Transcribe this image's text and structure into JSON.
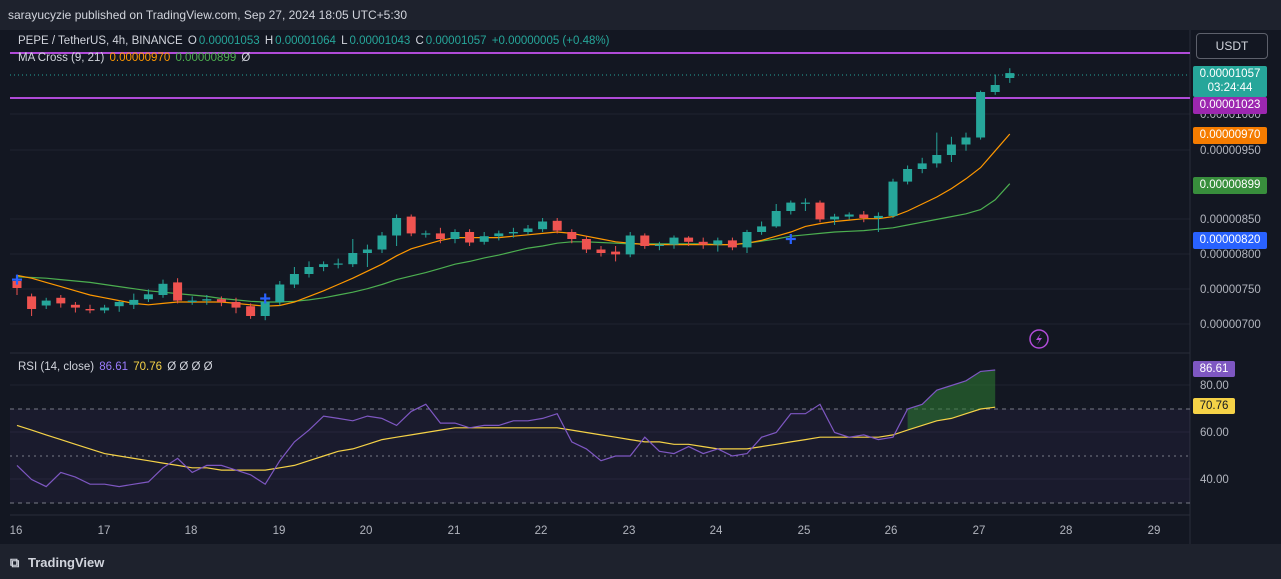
{
  "header": {
    "published": "sarayucyzie published on TradingView.com, Sep 27, 2024 18:05 UTC+5:30"
  },
  "legend": {
    "symbol": "PEPE / TetherUS, 4h, BINANCE",
    "o_label": "O",
    "o_value": "0.00001053",
    "h_label": "H",
    "h_value": "0.00001064",
    "l_label": "L",
    "l_value": "0.00001043",
    "c_label": "C",
    "c_value": "0.00001057",
    "change": "+0.00000005 (+0.48%)",
    "ma_label": "MA Cross (9, 21)",
    "ma_fast": "0.00000970",
    "ma_slow": "0.00000899",
    "ma_extra": "Ø"
  },
  "rsi_legend": {
    "label": "RSI (14, close)",
    "rsi": "86.61",
    "ma": "70.76",
    "extras": "Ø Ø Ø Ø"
  },
  "currency_button": "USDT",
  "price_axis": {
    "labels": [
      "0.00001000",
      "0.00000950",
      "0.00000850",
      "0.00000800",
      "0.00000750",
      "0.00000700"
    ],
    "tags": {
      "last_price": "0.00001057",
      "countdown": "03:24:44",
      "resistance": "0.00001023",
      "ma_fast": "0.00000970",
      "ma_slow": "0.00000899",
      "cross": "0.00000820"
    }
  },
  "rsi_axis": {
    "labels": [
      "80.00",
      "60.00",
      "40.00"
    ],
    "rsi_tag": "86.61",
    "ma_tag": "70.76"
  },
  "time_axis": [
    "16",
    "17",
    "18",
    "19",
    "20",
    "21",
    "22",
    "23",
    "24",
    "25",
    "26",
    "27",
    "28",
    "29"
  ],
  "footer": {
    "brand": "TradingView"
  },
  "colors": {
    "up": "#26a69a",
    "down": "#ef5350",
    "ma_fast": "#ff9800",
    "ma_slow": "#4caf50",
    "level": "#b04bd8",
    "rsi": "#7e57c2",
    "rsi_ma": "#f5d247",
    "cross": "#2962ff"
  },
  "chart_data": [
    {
      "type": "candlestick",
      "title": "PEPE / TetherUS, 4h, BINANCE",
      "x_labels": [
        "16",
        "17",
        "18",
        "19",
        "20",
        "21",
        "22",
        "23",
        "24",
        "25",
        "26",
        "27",
        "28",
        "29"
      ],
      "ylim": [
        6.8e-06,
        1.08e-05
      ],
      "horizontal_levels": [
        1.04e-05,
        1.023e-05
      ],
      "candles": [
        [
          7.6,
          7.5,
          7.68,
          7.4
        ],
        [
          7.38,
          7.2,
          7.42,
          7.1
        ],
        [
          7.25,
          7.32,
          7.36,
          7.2
        ],
        [
          7.36,
          7.28,
          7.4,
          7.22
        ],
        [
          7.26,
          7.22,
          7.3,
          7.15
        ],
        [
          7.2,
          7.18,
          7.26,
          7.14
        ],
        [
          7.18,
          7.22,
          7.26,
          7.14
        ],
        [
          7.24,
          7.3,
          7.32,
          7.16
        ],
        [
          7.26,
          7.33,
          7.42,
          7.2
        ],
        [
          7.34,
          7.41,
          7.48,
          7.3
        ],
        [
          7.4,
          7.56,
          7.62,
          7.36
        ],
        [
          7.58,
          7.32,
          7.64,
          7.28
        ],
        [
          7.3,
          7.32,
          7.38,
          7.26
        ],
        [
          7.32,
          7.34,
          7.4,
          7.26
        ],
        [
          7.34,
          7.3,
          7.38,
          7.24
        ],
        [
          7.3,
          7.22,
          7.36,
          7.14
        ],
        [
          7.24,
          7.1,
          7.28,
          7.06
        ],
        [
          7.1,
          7.3,
          7.32,
          7.04
        ],
        [
          7.3,
          7.55,
          7.6,
          7.25
        ],
        [
          7.55,
          7.7,
          7.8,
          7.5
        ],
        [
          7.7,
          7.8,
          7.88,
          7.65
        ],
        [
          7.8,
          7.84,
          7.88,
          7.74
        ],
        [
          7.84,
          7.85,
          7.92,
          7.78
        ],
        [
          7.84,
          8.0,
          8.2,
          7.8
        ],
        [
          8.0,
          8.05,
          8.12,
          7.8
        ],
        [
          8.05,
          8.25,
          8.3,
          8.0
        ],
        [
          8.25,
          8.5,
          8.55,
          8.1
        ],
        [
          8.52,
          8.28,
          8.55,
          8.24
        ],
        [
          8.28,
          8.28,
          8.32,
          8.22
        ],
        [
          8.28,
          8.2,
          8.36,
          8.14
        ],
        [
          8.2,
          8.3,
          8.34,
          8.14
        ],
        [
          8.3,
          8.15,
          8.34,
          8.1
        ],
        [
          8.16,
          8.24,
          8.3,
          8.12
        ],
        [
          8.24,
          8.28,
          8.32,
          8.18
        ],
        [
          8.28,
          8.3,
          8.36,
          8.22
        ],
        [
          8.3,
          8.35,
          8.4,
          8.26
        ],
        [
          8.34,
          8.45,
          8.5,
          8.3
        ],
        [
          8.46,
          8.32,
          8.5,
          8.28
        ],
        [
          8.3,
          8.2,
          8.34,
          8.14
        ],
        [
          8.2,
          8.05,
          8.24,
          8.0
        ],
        [
          8.05,
          8.0,
          8.1,
          7.95
        ],
        [
          8.02,
          7.98,
          8.1,
          7.88
        ],
        [
          7.98,
          8.25,
          8.3,
          7.94
        ],
        [
          8.25,
          8.1,
          8.28,
          8.06
        ],
        [
          8.1,
          8.12,
          8.16,
          8.04
        ],
        [
          8.12,
          8.22,
          8.25,
          8.06
        ],
        [
          8.22,
          8.16,
          8.24,
          8.1
        ],
        [
          8.16,
          8.12,
          8.22,
          8.06
        ],
        [
          8.12,
          8.18,
          8.22,
          8.02
        ],
        [
          8.18,
          8.08,
          8.22,
          8.04
        ],
        [
          8.08,
          8.3,
          8.33,
          8.0
        ],
        [
          8.3,
          8.38,
          8.45,
          8.26
        ],
        [
          8.38,
          8.6,
          8.7,
          8.36
        ],
        [
          8.6,
          8.72,
          8.75,
          8.55
        ],
        [
          8.72,
          8.72,
          8.78,
          8.6
        ],
        [
          8.72,
          8.48,
          8.75,
          8.44
        ],
        [
          8.48,
          8.52,
          8.56,
          8.4
        ],
        [
          8.52,
          8.55,
          8.58,
          8.48
        ],
        [
          8.55,
          8.5,
          8.6,
          8.44
        ],
        [
          8.5,
          8.53,
          8.58,
          8.3
        ],
        [
          8.53,
          9.02,
          9.06,
          8.5
        ],
        [
          9.02,
          9.2,
          9.25,
          8.98
        ],
        [
          9.2,
          9.28,
          9.36,
          9.14
        ],
        [
          9.28,
          9.4,
          9.72,
          9.22
        ],
        [
          9.4,
          9.55,
          9.66,
          9.3
        ],
        [
          9.55,
          9.65,
          9.72,
          9.46
        ],
        [
          9.65,
          10.3,
          10.32,
          9.62
        ],
        [
          10.3,
          10.4,
          10.55,
          10.26
        ],
        [
          10.5,
          10.57,
          10.64,
          10.43
        ]
      ],
      "ma_fast_9": [
        7.68,
        7.64,
        7.58,
        7.52,
        7.46,
        7.4,
        7.36,
        7.32,
        7.28,
        7.26,
        7.28,
        7.3,
        7.3,
        7.3,
        7.3,
        7.28,
        7.26,
        7.24,
        7.25,
        7.3,
        7.38,
        7.46,
        7.55,
        7.64,
        7.74,
        7.84,
        7.96,
        8.06,
        8.12,
        8.18,
        8.22,
        8.22,
        8.22,
        8.22,
        8.24,
        8.26,
        8.28,
        8.3,
        8.28,
        8.24,
        8.2,
        8.16,
        8.14,
        8.12,
        8.12,
        8.12,
        8.12,
        8.12,
        8.12,
        8.12,
        8.14,
        8.18,
        8.24,
        8.3,
        8.38,
        8.42,
        8.45,
        8.47,
        8.49,
        8.49,
        8.52,
        8.6,
        8.7,
        8.8,
        8.92,
        9.06,
        9.22,
        9.46,
        9.7
      ],
      "ma_slow_21": [
        7.66,
        7.65,
        7.64,
        7.62,
        7.6,
        7.58,
        7.55,
        7.52,
        7.49,
        7.46,
        7.44,
        7.42,
        7.4,
        7.38,
        7.35,
        7.33,
        7.31,
        7.3,
        7.3,
        7.31,
        7.33,
        7.36,
        7.4,
        7.44,
        7.49,
        7.55,
        7.62,
        7.67,
        7.72,
        7.78,
        7.84,
        7.88,
        7.93,
        7.97,
        8.02,
        8.07,
        8.1,
        8.14,
        8.16,
        8.16,
        8.15,
        8.14,
        8.13,
        8.13,
        8.13,
        8.13,
        8.13,
        8.13,
        8.12,
        8.12,
        8.14,
        8.17,
        8.2,
        8.24,
        8.26,
        8.28,
        8.3,
        8.31,
        8.32,
        8.34,
        8.36,
        8.4,
        8.44,
        8.48,
        8.52,
        8.56,
        8.62,
        8.76,
        8.99
      ]
    },
    {
      "type": "line",
      "title": "RSI (14, close)",
      "ylim": [
        20,
        90
      ],
      "levels": [
        70,
        50,
        30
      ],
      "series": [
        {
          "name": "RSI",
          "values": [
            46,
            40,
            37,
            43,
            41,
            38,
            38,
            37,
            38,
            39,
            45,
            49,
            43,
            46,
            46,
            44,
            42,
            38,
            48,
            56,
            61,
            67,
            66,
            65,
            67,
            66,
            63,
            69,
            72,
            64,
            64,
            62,
            63,
            63,
            65,
            65,
            66,
            68,
            56,
            53,
            48,
            50,
            50,
            58,
            52,
            51,
            54,
            51,
            53,
            50,
            51,
            58,
            60,
            68,
            68,
            72,
            60,
            58,
            59,
            57,
            58,
            70,
            72,
            78,
            80,
            82,
            86,
            86.61
          ]
        },
        {
          "name": "RSI MA",
          "values": [
            63,
            61,
            59,
            57,
            55,
            53,
            51,
            50,
            49,
            48,
            47,
            46,
            45,
            45,
            44,
            44,
            44,
            44,
            45,
            46,
            48,
            50,
            52,
            53,
            55,
            57,
            58,
            59,
            60,
            61,
            62,
            62,
            62,
            62,
            62,
            62,
            62,
            62,
            61,
            60,
            59,
            58,
            57,
            56,
            56,
            55,
            55,
            54,
            53,
            53,
            53,
            54,
            55,
            56,
            57,
            58,
            58,
            58,
            58,
            58,
            59,
            61,
            63,
            65,
            66,
            68,
            70,
            70.76
          ]
        }
      ]
    }
  ]
}
